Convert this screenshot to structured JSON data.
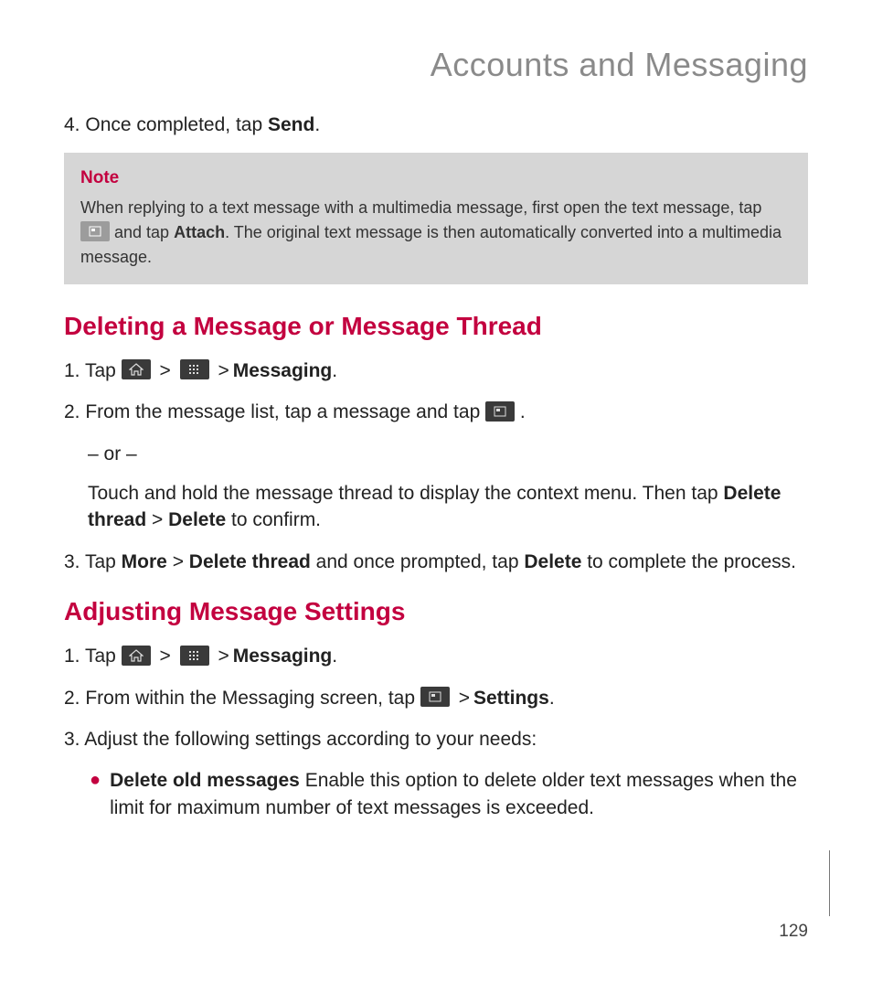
{
  "header": {
    "title": "Accounts and Messaging"
  },
  "step4": {
    "num": "4. ",
    "p1": "Once completed, tap ",
    "bold": "Send",
    "p2": "."
  },
  "note": {
    "title": "Note",
    "t1": "When replying to a text message with a multimedia message, first open the text message, tap ",
    "t2": " and tap ",
    "attach": "Attach",
    "t3": ". The original text message is then automatically converted into a multimedia message."
  },
  "section_delete": {
    "heading": "Deleting a Message or Message Thread",
    "s1": {
      "num": "1. ",
      "t1": "Tap ",
      "gt1": " > ",
      "gt2": " > ",
      "msg": "Messaging",
      "dot": "."
    },
    "s2": {
      "num": "2. ",
      "t1": "From the message list, tap a message and tap ",
      "dot": " ."
    },
    "or": "– or –",
    "s2b": {
      "t1": "Touch and hold the message thread to display the context menu. Then tap ",
      "b1": "Delete thread",
      "gt": " > ",
      "b2": "Delete",
      "t2": " to confirm."
    },
    "s3": {
      "num": "3. ",
      "t1": "Tap ",
      "b1": "More",
      "gt": " > ",
      "b2": "Delete thread",
      "t2": " and once prompted, tap ",
      "b3": "Delete",
      "t3": " to complete the process."
    }
  },
  "section_adjust": {
    "heading": "Adjusting Message Settings",
    "s1": {
      "num": "1. ",
      "t1": "Tap ",
      "gt1": " > ",
      "gt2": " > ",
      "msg": "Messaging",
      "dot": "."
    },
    "s2": {
      "num": "2. ",
      "t1": "From within the Messaging screen, tap ",
      "gt": " > ",
      "b1": "Settings",
      "dot": "."
    },
    "s3": {
      "num": "3. ",
      "t1": "Adjust the following settings according to your needs:"
    },
    "bullet1": {
      "b1": "Delete old messages",
      "t1": " Enable this option to delete older text messages when the limit for maximum number of text messages is exceeded."
    }
  },
  "page_number": "129"
}
